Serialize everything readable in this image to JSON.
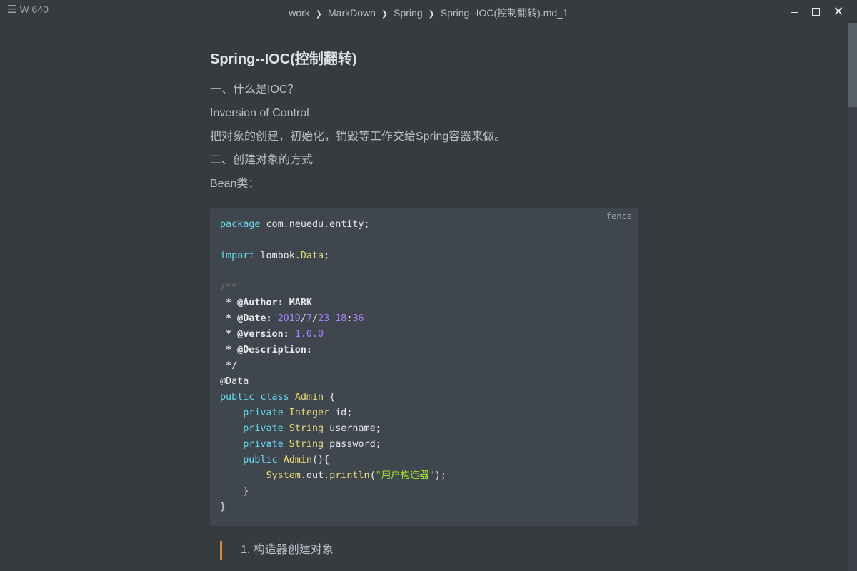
{
  "titlebar": {
    "menu_label": "W 640",
    "breadcrumb": [
      "work",
      "MarkDown",
      "Spring",
      "Spring--IOC(控制翻转).md_1"
    ]
  },
  "document": {
    "title": "Spring--IOC(控制翻转)",
    "paragraphs": [
      "一、什么是IOC？",
      "Inversion of Control",
      "把对象的创建，初始化，销毁等工作交给Spring容器来做。",
      "二、创建对象的方式",
      "Bean类："
    ],
    "code_block": {
      "language": "fence",
      "lines": [
        "package com.neuedu.entity;",
        "",
        "import lombok.Data;",
        "",
        "/**",
        " * @Author: MARK",
        " * @Date: 2019/7/23 18:36",
        " * @version: 1.0.0",
        " * @Description:",
        " */",
        "@Data",
        "public class Admin {",
        "    private Integer id;",
        "    private String username;",
        "    private String password;",
        "    public Admin(){",
        "        System.out.println(\"用户构造器\");",
        "    }",
        "}"
      ]
    },
    "quote": "1. 构造器创建对象"
  },
  "colors": {
    "background": "#363b40",
    "code_background": "#3f464d",
    "keyword": "#66d9ef",
    "type": "#e6db74",
    "number": "#ae81ff",
    "string": "#a6e22e",
    "quote_bar": "#d88a3b"
  },
  "icons": [
    "menu-icon",
    "chevron-right-icon",
    "minimize-icon",
    "maximize-icon",
    "close-icon"
  ]
}
